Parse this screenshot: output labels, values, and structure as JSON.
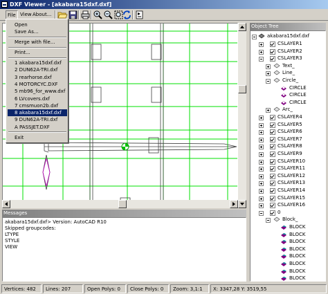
{
  "window": {
    "title": "DXF Viewer - [akabara15dxf.dxf]"
  },
  "menubar": {
    "items": [
      {
        "label": "File"
      },
      {
        "label": "View"
      },
      {
        "label": "About..."
      }
    ]
  },
  "toolbar": {
    "buttons": [
      "open-folder-icon",
      "save-icon",
      "print-icon",
      "zoom-in-icon",
      "zoom-out-icon",
      "zoom-window-icon",
      "redraw-icon",
      "layer-icon"
    ]
  },
  "file_menu": {
    "open": "Open",
    "save_as": "Save As...",
    "merge": "Merge with file...",
    "print": "Print...",
    "recent": [
      "1 akabara15dxf.dxf",
      "2 DUN62A-TRI.dxf",
      "3 rearhorse.dxf",
      "4 MOTORCYC.DXF",
      "5 mb96_for_www.dxf",
      "6 LVcovers.dxf",
      "7 cmsmuon2b.dxf",
      "8 akabara15dxf.dxf",
      "9 DUN62A-TRI.dxf",
      "A PASSJET.DXF"
    ],
    "selected_recent_index": 7,
    "exit": "Exit"
  },
  "messages": {
    "header": "Messages",
    "lines": [
      "akabara15dxf.dxf> Version: AutoCAD R10",
      "Skipped groupcodes:",
      "LTYPE",
      "STYLE",
      "VIEW"
    ]
  },
  "object_tree": {
    "header": "Object Tree",
    "root": "akabara15dxf.dxf",
    "rows": [
      {
        "label": "CSLAYER1",
        "level": 1,
        "type": "layer",
        "expander": "plus"
      },
      {
        "label": "CSLAYER2",
        "level": 1,
        "type": "layer",
        "expander": "plus"
      },
      {
        "label": "CSLAYER3",
        "level": 1,
        "type": "layer",
        "expander": "minus"
      },
      {
        "label": "Text_",
        "level": 2,
        "type": "text",
        "expander": "plus"
      },
      {
        "label": "Line_",
        "level": 2,
        "type": "line",
        "expander": "plus"
      },
      {
        "label": "Circle_",
        "level": 2,
        "type": "circle",
        "expander": "minus"
      },
      {
        "label": "CIRCLE",
        "level": 3,
        "type": "circle-item"
      },
      {
        "label": "CIRCLE",
        "level": 3,
        "type": "circle-item"
      },
      {
        "label": "CIRCLE",
        "level": 3,
        "type": "circle-item"
      },
      {
        "label": "Arc_",
        "level": 2,
        "type": "arc",
        "expander": "plus"
      },
      {
        "label": "CSLAYER4",
        "level": 1,
        "type": "layer",
        "expander": "plus"
      },
      {
        "label": "CSLAYER5",
        "level": 1,
        "type": "layer",
        "expander": "plus"
      },
      {
        "label": "CSLAYER6",
        "level": 1,
        "type": "layer",
        "expander": "plus"
      },
      {
        "label": "CSLAYER7",
        "level": 1,
        "type": "layer",
        "expander": "plus"
      },
      {
        "label": "CSLAYER8",
        "level": 1,
        "type": "layer",
        "expander": "plus"
      },
      {
        "label": "CSLAYER9",
        "level": 1,
        "type": "layer",
        "expander": "plus"
      },
      {
        "label": "CSLAYER10",
        "level": 1,
        "type": "layer",
        "expander": "plus"
      },
      {
        "label": "CSLAYER11",
        "level": 1,
        "type": "layer",
        "expander": "plus"
      },
      {
        "label": "CSLAYER12",
        "level": 1,
        "type": "layer",
        "expander": "plus"
      },
      {
        "label": "CSLAYER13",
        "level": 1,
        "type": "layer",
        "expander": "plus"
      },
      {
        "label": "CSLAYER14",
        "level": 1,
        "type": "layer",
        "expander": "plus"
      },
      {
        "label": "CSLAYER15",
        "level": 1,
        "type": "layer",
        "expander": "plus"
      },
      {
        "label": "CSLAYER16",
        "level": 1,
        "type": "layer",
        "expander": "plus"
      },
      {
        "label": "0",
        "level": 1,
        "type": "layer",
        "expander": "minus"
      },
      {
        "label": "Block_",
        "level": 2,
        "type": "block",
        "expander": "minus"
      },
      {
        "label": "BLOCK",
        "level": 3,
        "type": "block-item"
      },
      {
        "label": "BLOCK",
        "level": 3,
        "type": "block-item"
      },
      {
        "label": "BLOCK",
        "level": 3,
        "type": "block-item"
      },
      {
        "label": "BLOCK",
        "level": 3,
        "type": "block-item"
      },
      {
        "label": "BLOCK",
        "level": 3,
        "type": "block-item"
      },
      {
        "label": "BLOCK",
        "level": 3,
        "type": "block-item"
      },
      {
        "label": "BLOCK",
        "level": 3,
        "type": "block-item"
      },
      {
        "label": "BLOCK",
        "level": 3,
        "type": "block-item"
      },
      {
        "label": "BLOCK",
        "level": 3,
        "type": "block-item"
      }
    ]
  },
  "statusbar": {
    "vertices": "Vertices: 482",
    "lines": "Lines: 207",
    "open_polys": "Open Polys: 0",
    "close_polys": "Close Polys: 0",
    "zoom": "Zoom: 3,1:1",
    "coords": "X: 3347,28  Y: 3519,55"
  },
  "colors": {
    "grid": "#00e000",
    "title_active": "#0a246a",
    "selection": "#0a246a",
    "circle_marker": "#00c000",
    "block_icon": "#800080"
  }
}
